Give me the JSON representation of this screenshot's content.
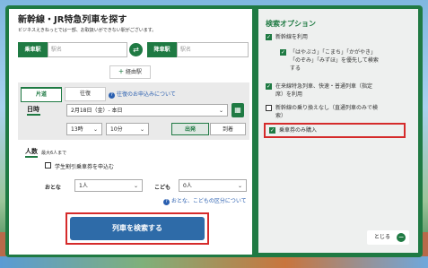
{
  "header": {
    "title": "新幹線・JR特急列車を探す",
    "subtitle": "ビジネスえきねっとでは一部、お取扱いができない駅がございます。"
  },
  "stations": {
    "from_label": "乗車駅",
    "from_placeholder": "駅名",
    "to_label": "降車駅",
    "to_placeholder": "駅名",
    "via_label": "経由駅"
  },
  "tabs": {
    "oneway": "片道",
    "roundtrip": "往復",
    "roundtrip_help": "往復のお申込みについて"
  },
  "datetime": {
    "label": "日時",
    "date": "2月18日（金）- 本日",
    "hour": "13時",
    "minute": "10分",
    "depart": "出発",
    "arrive": "到着"
  },
  "people": {
    "label": "人数",
    "max_note": "最大6人まで",
    "student_discount": "学生割引乗車券を申込む",
    "adult_label": "おとな",
    "adult_value": "1人",
    "child_label": "こども",
    "child_value": "0人",
    "child_help": "おとな、こどもの区分について"
  },
  "search_button": "列車を検索する",
  "options": {
    "title": "検索オプション",
    "use_shinkansen": "新幹線を利用",
    "priority_line1": "「はやぶさ」「こまち」「かがやき」",
    "priority_line2": "「のぞみ」「みずほ」を優先して検索",
    "priority_line3": "する",
    "conventional_line1": "在来線特急列車、快速・普通列車（指定",
    "conventional_line2": "席）を利用",
    "no_transfer_line1": "新幹線の乗り換えなし（直通列車のみで検",
    "no_transfer_line2": "索）",
    "ticket_only": "乗車券のみ購入",
    "close": "とじる"
  }
}
